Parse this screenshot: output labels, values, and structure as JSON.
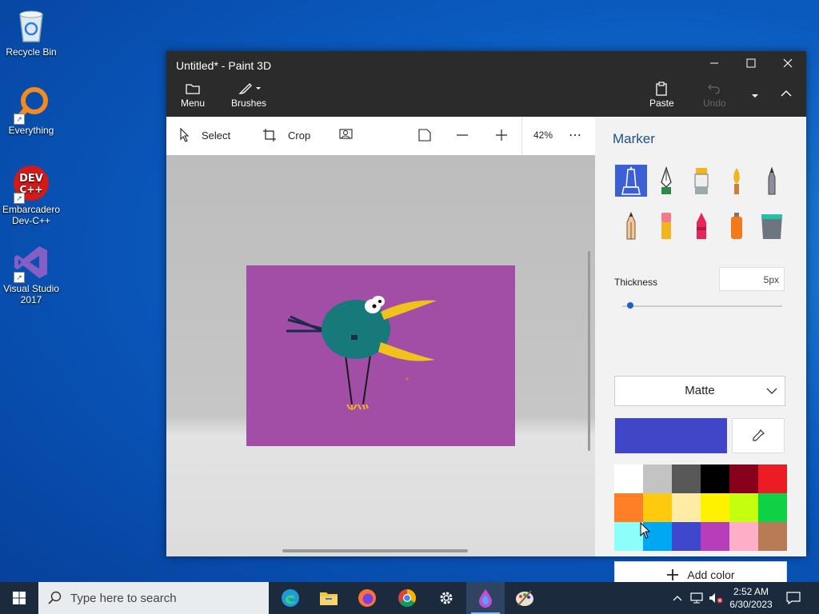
{
  "desktop": {
    "icons": [
      {
        "label": "Recycle Bin"
      },
      {
        "label": "Everything"
      },
      {
        "label": "Embarcadero Dev-C++"
      },
      {
        "label": "Visual Studio 2017"
      }
    ]
  },
  "window": {
    "title": "Untitled* - Paint 3D",
    "ribbon": {
      "menu": "Menu",
      "brushes": "Brushes",
      "paste": "Paste",
      "undo": "Undo"
    },
    "toolbar": {
      "select": "Select",
      "crop": "Crop",
      "zoom": "42%",
      "more": "⋯"
    }
  },
  "panel": {
    "title": "Marker",
    "brushes": [
      "marker-icon",
      "calligraphy-pen-icon",
      "oil-brush-icon",
      "watercolor-icon",
      "pixel-pen-icon",
      "pencil-icon",
      "eraser-icon",
      "crayon-icon",
      "spray-can-icon",
      "fill-bucket-icon"
    ],
    "thickness_label": "Thickness",
    "thickness_value": "5px",
    "thickness_level": 0.05,
    "finish": "Matte",
    "current_color": "#3f47c8",
    "palette": [
      "#ffffff",
      "#c3c3c3",
      "#585858",
      "#000000",
      "#88001b",
      "#ec1c24",
      "#ff7f27",
      "#ffc90e",
      "#fdeca6",
      "#fff200",
      "#c4ff0e",
      "#0ed145",
      "#8cfffb",
      "#00a8f3",
      "#3f48cc",
      "#b83dba",
      "#ffaec8",
      "#b97a56"
    ],
    "add_color": "Add color"
  },
  "taskbar": {
    "search_placeholder": "Type here to search",
    "time": "2:52 AM",
    "date": "6/30/2023"
  }
}
